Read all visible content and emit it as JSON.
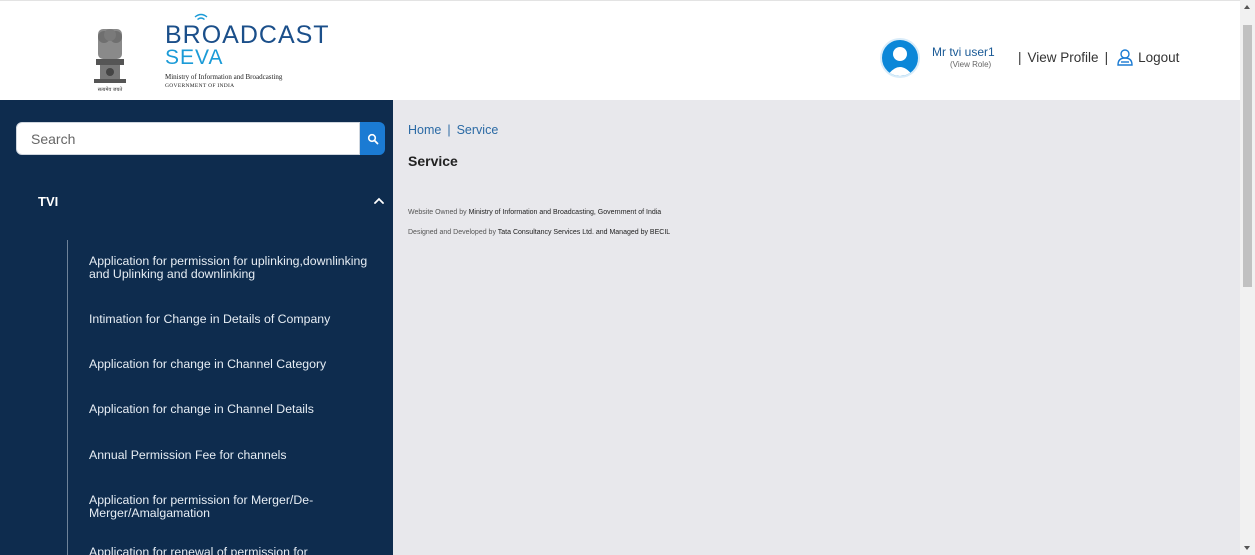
{
  "header": {
    "emblem_caption": "सत्यमेव जयते",
    "brand_title": "BROADCAST",
    "brand_sub": "SEVA",
    "brand_ministry": "Ministry of Information and Broadcasting",
    "brand_gov": "GOVERNMENT OF INDIA",
    "user_name": "Mr tvi user1",
    "user_role": "(View Role)",
    "view_profile": "View Profile",
    "logout": "Logout",
    "separator": "|"
  },
  "sidebar": {
    "search_placeholder": "Search",
    "section_title": "TVI",
    "items": [
      "Application for permission for uplinking,downlinking and Uplinking and downlinking",
      "Intimation for Change in Details of Company",
      "Application for change in Channel Category",
      "Application for change in Channel Details",
      "Annual Permission Fee for channels",
      "Application for permission for Merger/De-Merger/Amalgamation",
      "Application for renewal of permission for"
    ]
  },
  "main": {
    "breadcrumb": [
      "Home",
      "Service"
    ],
    "page_title": "Service",
    "footer_owned_prefix": "Website Owned by ",
    "footer_owned_org": "Ministry of Information and Broadcasting, Government of India",
    "footer_dev_prefix": "Designed and Developed by ",
    "footer_dev_org": "Tata Consultancy Services Ltd. and Managed by BECIL"
  },
  "colors": {
    "sidebar_bg": "#0e2c4e",
    "main_bg": "#e8e8ec",
    "accent": "#1b7bd3",
    "brand_blue": "#1b4f8a"
  },
  "icons": [
    "emblem-icon",
    "wifi-icon",
    "avatar-icon",
    "logout-icon",
    "search-icon",
    "chevron-up-icon"
  ]
}
